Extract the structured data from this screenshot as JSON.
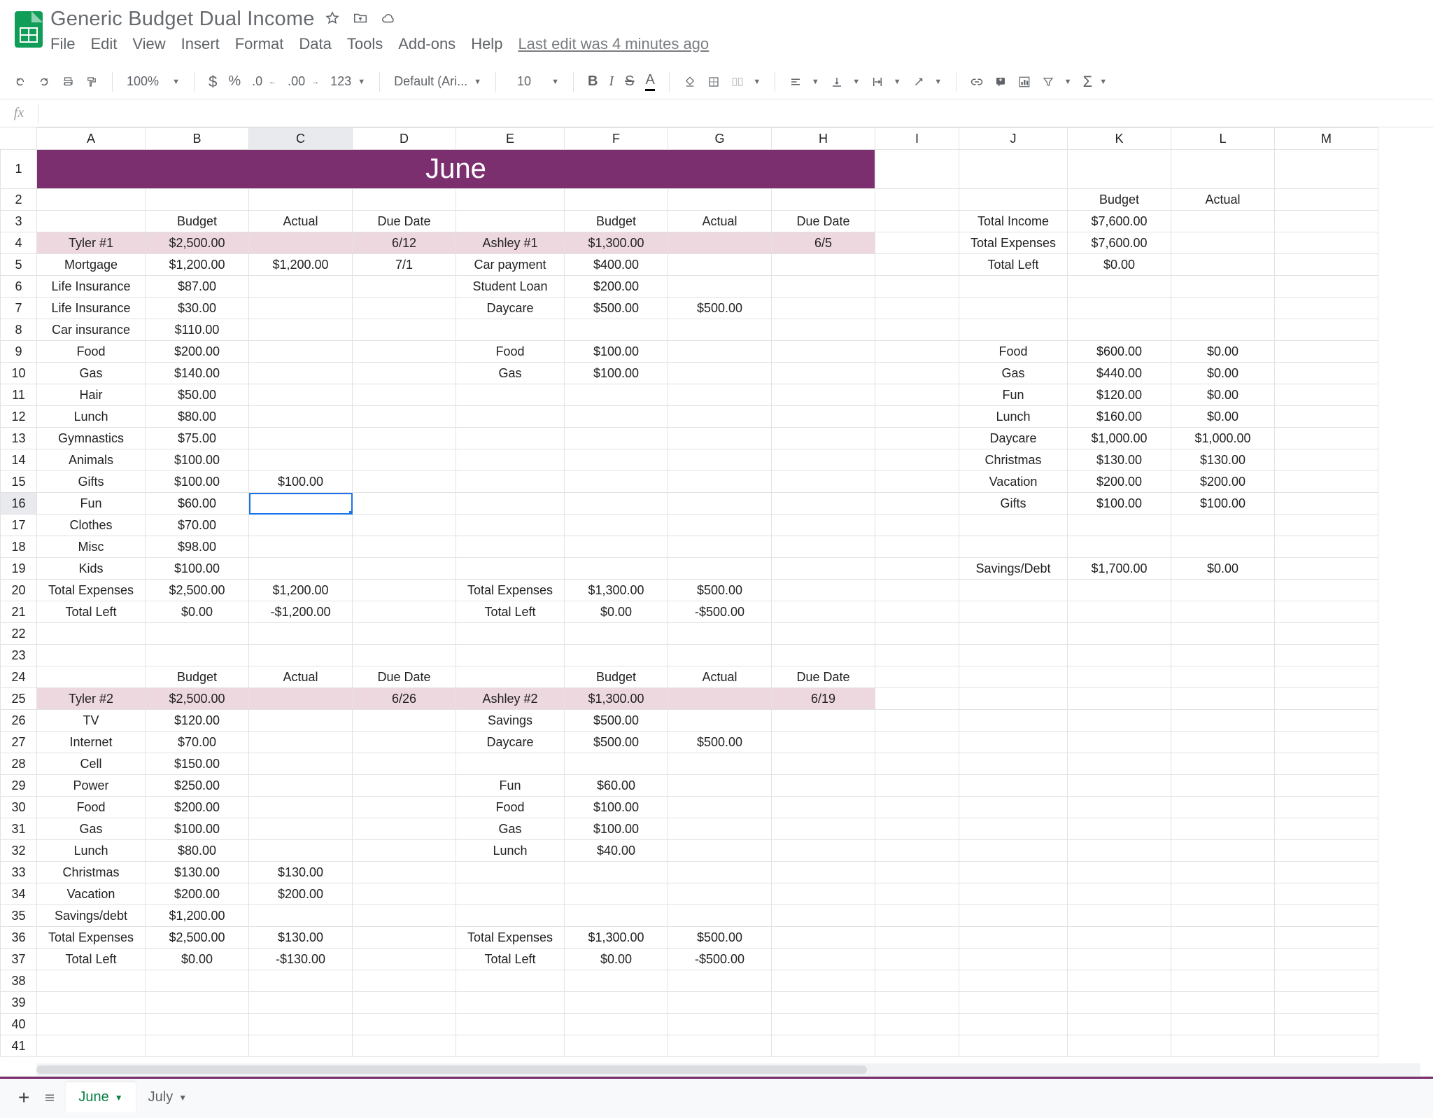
{
  "doc": {
    "title": "Generic Budget  Dual Income",
    "last_edit": "Last edit was 4 minutes ago"
  },
  "menus": [
    "File",
    "Edit",
    "View",
    "Insert",
    "Format",
    "Data",
    "Tools",
    "Add-ons",
    "Help"
  ],
  "toolbar": {
    "zoom": "100%",
    "font": "Default (Ari...",
    "font_size": "10"
  },
  "columns": [
    "A",
    "B",
    "C",
    "D",
    "E",
    "F",
    "G",
    "H",
    "I",
    "J",
    "K",
    "L",
    "M"
  ],
  "active_column": "C",
  "active_row": 16,
  "banner": "June",
  "col_widths": [
    "col-A",
    "col-B",
    "col-C",
    "col-D",
    "col-E",
    "col-F",
    "col-G",
    "col-H",
    "col-I",
    "col-J",
    "col-K",
    "col-L",
    "col-M"
  ],
  "rows": [
    {
      "n": 2,
      "cells": {
        "K": {
          "t": "Budget",
          "a": "cen"
        },
        "L": {
          "t": "Actual",
          "a": "cen"
        }
      }
    },
    {
      "n": 3,
      "cells": {
        "B": {
          "t": "Budget",
          "a": "cen"
        },
        "C": {
          "t": "Actual",
          "a": "cen"
        },
        "D": {
          "t": "Due Date",
          "a": "cen"
        },
        "F": {
          "t": "Budget",
          "a": "cen"
        },
        "G": {
          "t": "Actual",
          "a": "cen"
        },
        "H": {
          "t": "Due Date",
          "a": "cen"
        },
        "J": {
          "t": "Total Income",
          "a": "cen"
        },
        "K": {
          "t": "$7,600.00",
          "a": "cen"
        }
      }
    },
    {
      "n": 4,
      "pink": true,
      "cells": {
        "A": {
          "t": "Tyler #1",
          "a": "cen",
          "p": true
        },
        "B": {
          "t": "$2,500.00",
          "a": "cen",
          "p": true
        },
        "C": {
          "t": "",
          "p": true
        },
        "D": {
          "t": "6/12",
          "a": "cen",
          "p": true
        },
        "E": {
          "t": "Ashley #1",
          "a": "cen",
          "p": true
        },
        "F": {
          "t": "$1,300.00",
          "a": "cen",
          "p": true
        },
        "G": {
          "t": "",
          "p": true
        },
        "H": {
          "t": "6/5",
          "a": "cen",
          "p": true
        },
        "J": {
          "t": "Total Expenses",
          "a": "cen"
        },
        "K": {
          "t": "$7,600.00",
          "a": "cen"
        }
      }
    },
    {
      "n": 5,
      "cells": {
        "A": {
          "t": "Mortgage",
          "a": "cen"
        },
        "B": {
          "t": "$1,200.00",
          "a": "cen"
        },
        "C": {
          "t": "$1,200.00",
          "a": "cen"
        },
        "D": {
          "t": "7/1",
          "a": "cen"
        },
        "E": {
          "t": "Car payment",
          "a": "cen"
        },
        "F": {
          "t": "$400.00",
          "a": "cen"
        },
        "J": {
          "t": "Total Left",
          "a": "cen"
        },
        "K": {
          "t": "$0.00",
          "a": "cen"
        }
      }
    },
    {
      "n": 6,
      "cells": {
        "A": {
          "t": "Life Insurance",
          "a": "cen"
        },
        "B": {
          "t": "$87.00",
          "a": "cen"
        },
        "E": {
          "t": "Student Loan",
          "a": "cen"
        },
        "F": {
          "t": "$200.00",
          "a": "cen"
        }
      }
    },
    {
      "n": 7,
      "cells": {
        "A": {
          "t": "Life Insurance",
          "a": "cen"
        },
        "B": {
          "t": "$30.00",
          "a": "cen"
        },
        "E": {
          "t": "Daycare",
          "a": "cen"
        },
        "F": {
          "t": "$500.00",
          "a": "cen"
        },
        "G": {
          "t": "$500.00",
          "a": "cen"
        }
      }
    },
    {
      "n": 8,
      "cells": {
        "A": {
          "t": "Car insurance",
          "a": "cen"
        },
        "B": {
          "t": "$110.00",
          "a": "cen"
        }
      }
    },
    {
      "n": 9,
      "cells": {
        "A": {
          "t": "Food",
          "a": "cen"
        },
        "B": {
          "t": "$200.00",
          "a": "cen"
        },
        "E": {
          "t": "Food",
          "a": "cen"
        },
        "F": {
          "t": "$100.00",
          "a": "cen"
        },
        "J": {
          "t": "Food",
          "a": "cen"
        },
        "K": {
          "t": "$600.00",
          "a": "cen"
        },
        "L": {
          "t": "$0.00",
          "a": "cen"
        }
      }
    },
    {
      "n": 10,
      "cells": {
        "A": {
          "t": "Gas",
          "a": "cen"
        },
        "B": {
          "t": "$140.00",
          "a": "cen"
        },
        "E": {
          "t": "Gas",
          "a": "cen"
        },
        "F": {
          "t": "$100.00",
          "a": "cen"
        },
        "J": {
          "t": "Gas",
          "a": "cen"
        },
        "K": {
          "t": "$440.00",
          "a": "cen"
        },
        "L": {
          "t": "$0.00",
          "a": "cen"
        }
      }
    },
    {
      "n": 11,
      "cells": {
        "A": {
          "t": "Hair",
          "a": "cen"
        },
        "B": {
          "t": "$50.00",
          "a": "cen"
        },
        "J": {
          "t": "Fun",
          "a": "cen"
        },
        "K": {
          "t": "$120.00",
          "a": "cen"
        },
        "L": {
          "t": "$0.00",
          "a": "cen"
        }
      }
    },
    {
      "n": 12,
      "cells": {
        "A": {
          "t": "Lunch",
          "a": "cen"
        },
        "B": {
          "t": "$80.00",
          "a": "cen"
        },
        "J": {
          "t": "Lunch",
          "a": "cen"
        },
        "K": {
          "t": "$160.00",
          "a": "cen"
        },
        "L": {
          "t": "$0.00",
          "a": "cen"
        }
      }
    },
    {
      "n": 13,
      "cells": {
        "A": {
          "t": "Gymnastics",
          "a": "cen"
        },
        "B": {
          "t": "$75.00",
          "a": "cen"
        },
        "J": {
          "t": "Daycare",
          "a": "cen"
        },
        "K": {
          "t": "$1,000.00",
          "a": "cen"
        },
        "L": {
          "t": "$1,000.00",
          "a": "cen"
        }
      }
    },
    {
      "n": 14,
      "cells": {
        "A": {
          "t": "Animals",
          "a": "cen"
        },
        "B": {
          "t": "$100.00",
          "a": "cen"
        },
        "J": {
          "t": "Christmas",
          "a": "cen"
        },
        "K": {
          "t": "$130.00",
          "a": "cen"
        },
        "L": {
          "t": "$130.00",
          "a": "cen"
        }
      }
    },
    {
      "n": 15,
      "cells": {
        "A": {
          "t": "Gifts",
          "a": "cen"
        },
        "B": {
          "t": "$100.00",
          "a": "cen"
        },
        "C": {
          "t": "$100.00",
          "a": "cen"
        },
        "J": {
          "t": "Vacation",
          "a": "cen"
        },
        "K": {
          "t": "$200.00",
          "a": "cen"
        },
        "L": {
          "t": "$200.00",
          "a": "cen"
        }
      }
    },
    {
      "n": 16,
      "cells": {
        "A": {
          "t": "Fun",
          "a": "cen"
        },
        "B": {
          "t": "$60.00",
          "a": "cen"
        },
        "C": {
          "t": "",
          "active": true
        },
        "J": {
          "t": "Gifts",
          "a": "cen"
        },
        "K": {
          "t": "$100.00",
          "a": "cen"
        },
        "L": {
          "t": "$100.00",
          "a": "cen"
        }
      }
    },
    {
      "n": 17,
      "cells": {
        "A": {
          "t": "Clothes",
          "a": "cen"
        },
        "B": {
          "t": "$70.00",
          "a": "cen"
        }
      }
    },
    {
      "n": 18,
      "cells": {
        "A": {
          "t": "Misc",
          "a": "cen"
        },
        "B": {
          "t": "$98.00",
          "a": "cen"
        }
      }
    },
    {
      "n": 19,
      "cells": {
        "A": {
          "t": "Kids",
          "a": "cen"
        },
        "B": {
          "t": "$100.00",
          "a": "cen"
        },
        "J": {
          "t": "Savings/Debt",
          "a": "cen"
        },
        "K": {
          "t": "$1,700.00",
          "a": "cen"
        },
        "L": {
          "t": "$0.00",
          "a": "cen"
        }
      }
    },
    {
      "n": 20,
      "cells": {
        "A": {
          "t": "Total Expenses",
          "a": "cen"
        },
        "B": {
          "t": "$2,500.00",
          "a": "cen"
        },
        "C": {
          "t": "$1,200.00",
          "a": "cen"
        },
        "E": {
          "t": "Total Expenses",
          "a": "cen"
        },
        "F": {
          "t": "$1,300.00",
          "a": "cen"
        },
        "G": {
          "t": "$500.00",
          "a": "cen"
        }
      }
    },
    {
      "n": 21,
      "cells": {
        "A": {
          "t": "Total Left",
          "a": "cen"
        },
        "B": {
          "t": "$0.00",
          "a": "cen"
        },
        "C": {
          "t": "-$1,200.00",
          "a": "cen"
        },
        "E": {
          "t": "Total Left",
          "a": "cen"
        },
        "F": {
          "t": "$0.00",
          "a": "cen"
        },
        "G": {
          "t": "-$500.00",
          "a": "cen"
        }
      }
    },
    {
      "n": 22,
      "cells": {}
    },
    {
      "n": 23,
      "cells": {}
    },
    {
      "n": 24,
      "cells": {
        "B": {
          "t": "Budget",
          "a": "cen"
        },
        "C": {
          "t": "Actual",
          "a": "cen"
        },
        "D": {
          "t": "Due Date",
          "a": "cen"
        },
        "F": {
          "t": "Budget",
          "a": "cen"
        },
        "G": {
          "t": "Actual",
          "a": "cen"
        },
        "H": {
          "t": "Due Date",
          "a": "cen"
        }
      }
    },
    {
      "n": 25,
      "pink": true,
      "cells": {
        "A": {
          "t": "Tyler #2",
          "a": "cen",
          "p": true
        },
        "B": {
          "t": "$2,500.00",
          "a": "cen",
          "p": true
        },
        "C": {
          "t": "",
          "p": true
        },
        "D": {
          "t": "6/26",
          "a": "cen",
          "p": true
        },
        "E": {
          "t": "Ashley #2",
          "a": "cen",
          "p": true
        },
        "F": {
          "t": "$1,300.00",
          "a": "cen",
          "p": true
        },
        "G": {
          "t": "",
          "p": true
        },
        "H": {
          "t": "6/19",
          "a": "cen",
          "p": true
        }
      }
    },
    {
      "n": 26,
      "cells": {
        "A": {
          "t": "TV",
          "a": "cen"
        },
        "B": {
          "t": "$120.00",
          "a": "cen"
        },
        "E": {
          "t": "Savings",
          "a": "cen"
        },
        "F": {
          "t": "$500.00",
          "a": "cen"
        }
      }
    },
    {
      "n": 27,
      "cells": {
        "A": {
          "t": "Internet",
          "a": "cen"
        },
        "B": {
          "t": "$70.00",
          "a": "cen"
        },
        "E": {
          "t": "Daycare",
          "a": "cen"
        },
        "F": {
          "t": "$500.00",
          "a": "cen"
        },
        "G": {
          "t": "$500.00",
          "a": "cen"
        }
      }
    },
    {
      "n": 28,
      "cells": {
        "A": {
          "t": "Cell",
          "a": "cen"
        },
        "B": {
          "t": "$150.00",
          "a": "cen"
        }
      }
    },
    {
      "n": 29,
      "cells": {
        "A": {
          "t": "Power",
          "a": "cen"
        },
        "B": {
          "t": "$250.00",
          "a": "cen"
        },
        "E": {
          "t": "Fun",
          "a": "cen"
        },
        "F": {
          "t": "$60.00",
          "a": "cen"
        }
      }
    },
    {
      "n": 30,
      "cells": {
        "A": {
          "t": "Food",
          "a": "cen"
        },
        "B": {
          "t": "$200.00",
          "a": "cen"
        },
        "E": {
          "t": "Food",
          "a": "cen"
        },
        "F": {
          "t": "$100.00",
          "a": "cen"
        }
      }
    },
    {
      "n": 31,
      "cells": {
        "A": {
          "t": "Gas",
          "a": "cen"
        },
        "B": {
          "t": "$100.00",
          "a": "cen"
        },
        "E": {
          "t": "Gas",
          "a": "cen"
        },
        "F": {
          "t": "$100.00",
          "a": "cen"
        }
      }
    },
    {
      "n": 32,
      "cells": {
        "A": {
          "t": "Lunch",
          "a": "cen"
        },
        "B": {
          "t": "$80.00",
          "a": "cen"
        },
        "E": {
          "t": "Lunch",
          "a": "cen"
        },
        "F": {
          "t": "$40.00",
          "a": "cen"
        }
      }
    },
    {
      "n": 33,
      "cells": {
        "A": {
          "t": "Christmas",
          "a": "cen"
        },
        "B": {
          "t": "$130.00",
          "a": "cen"
        },
        "C": {
          "t": "$130.00",
          "a": "cen"
        }
      }
    },
    {
      "n": 34,
      "cells": {
        "A": {
          "t": "Vacation",
          "a": "cen"
        },
        "B": {
          "t": "$200.00",
          "a": "cen"
        },
        "C": {
          "t": "$200.00",
          "a": "cen"
        }
      }
    },
    {
      "n": 35,
      "cells": {
        "A": {
          "t": "Savings/debt",
          "a": "cen"
        },
        "B": {
          "t": "$1,200.00",
          "a": "cen"
        }
      }
    },
    {
      "n": 36,
      "cells": {
        "A": {
          "t": "Total Expenses",
          "a": "cen"
        },
        "B": {
          "t": "$2,500.00",
          "a": "cen"
        },
        "C": {
          "t": "$130.00",
          "a": "cen"
        },
        "E": {
          "t": "Total Expenses",
          "a": "cen"
        },
        "F": {
          "t": "$1,300.00",
          "a": "cen"
        },
        "G": {
          "t": "$500.00",
          "a": "cen"
        }
      }
    },
    {
      "n": 37,
      "cells": {
        "A": {
          "t": "Total Left",
          "a": "cen"
        },
        "B": {
          "t": "$0.00",
          "a": "cen"
        },
        "C": {
          "t": "-$130.00",
          "a": "cen"
        },
        "E": {
          "t": "Total Left",
          "a": "cen"
        },
        "F": {
          "t": "$0.00",
          "a": "cen"
        },
        "G": {
          "t": "-$500.00",
          "a": "cen"
        }
      }
    },
    {
      "n": 38,
      "cells": {}
    },
    {
      "n": 39,
      "cells": {}
    },
    {
      "n": 40,
      "cells": {}
    },
    {
      "n": 41,
      "cells": {}
    }
  ],
  "tabs": [
    {
      "label": "June",
      "active": true
    },
    {
      "label": "July",
      "active": false
    }
  ]
}
